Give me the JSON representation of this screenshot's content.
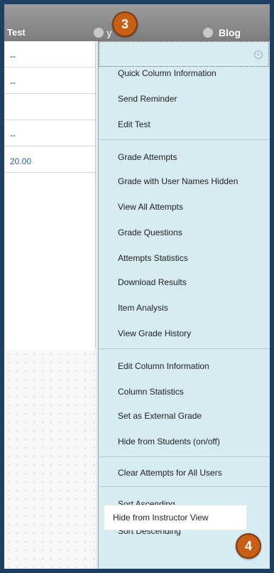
{
  "header": {
    "col_test": "Test",
    "col_partial": "y",
    "col_blog": "Blog"
  },
  "grid": {
    "rows": [
      "--",
      "--",
      "",
      "--",
      "20.00"
    ]
  },
  "callouts": {
    "step3": "3",
    "step4": "4"
  },
  "menu": {
    "close_icon": "close-icon",
    "items": [
      "Quick Column Information",
      "Send Reminder",
      "Edit Test",
      "Grade Attempts",
      "Grade with User Names Hidden",
      "View All Attempts",
      "Grade Questions",
      "Attempts Statistics",
      "Download Results",
      "Item Analysis",
      "View Grade History",
      "Edit Column Information",
      "Column Statistics",
      "Set as External Grade",
      "Hide from Students (on/off)",
      "Clear Attempts for All Users",
      "Sort Ascending",
      "Sort Descending",
      "Hide from Instructor View"
    ]
  }
}
